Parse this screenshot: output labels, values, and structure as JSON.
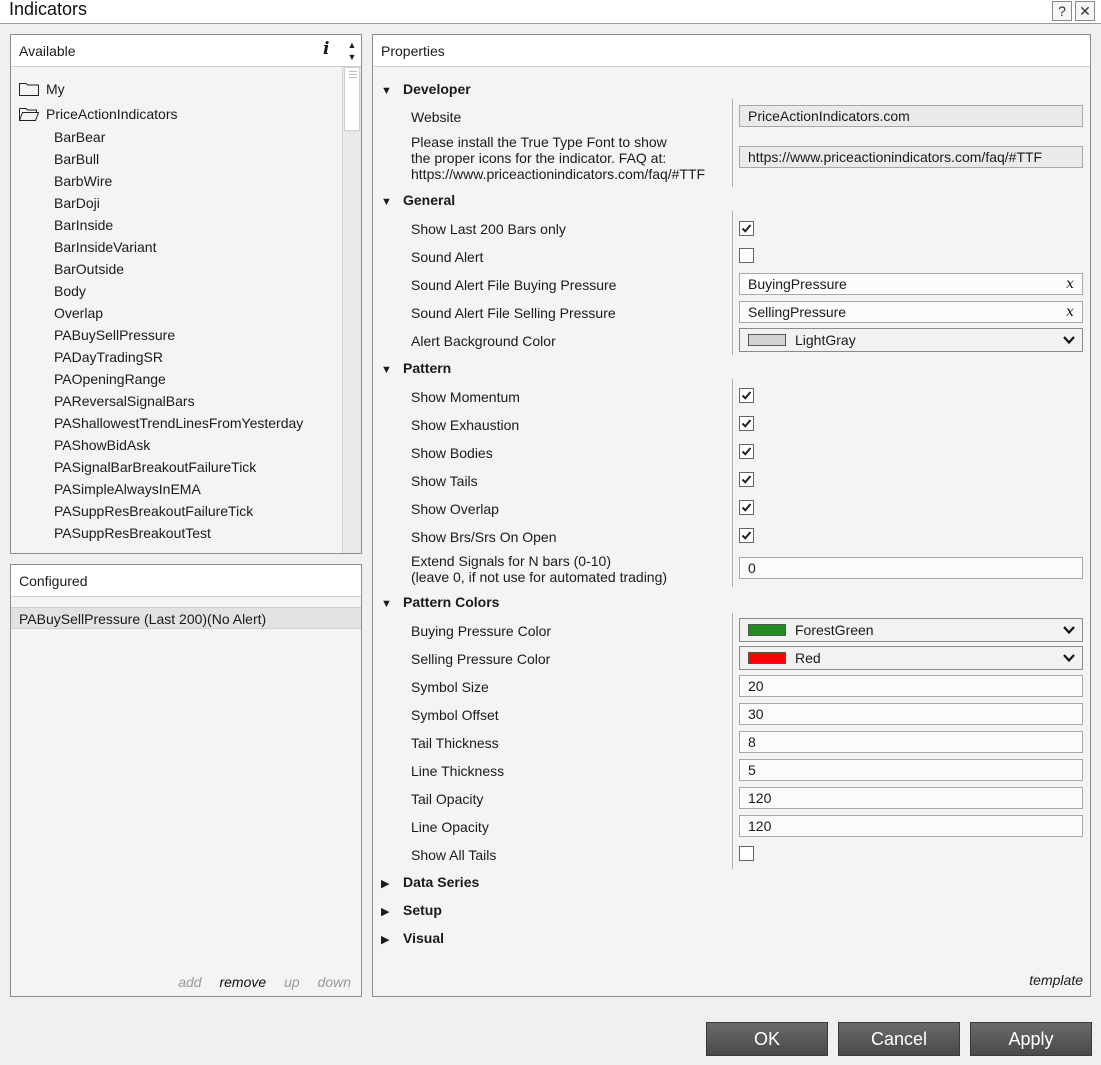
{
  "window": {
    "title": "Indicators",
    "help": "?",
    "close": "✕"
  },
  "available": {
    "header": "Available",
    "info": "i",
    "folders": [
      "My",
      "PriceActionIndicators"
    ],
    "items": [
      "BarBear",
      "BarBull",
      "BarbWire",
      "BarDoji",
      "BarInside",
      "BarInsideVariant",
      "BarOutside",
      "Body",
      "Overlap",
      "PABuySellPressure",
      "PADayTradingSR",
      "PAOpeningRange",
      "PAReversalSignalBars",
      "PAShallowestTrendLinesFromYesterday",
      "PAShowBidAsk",
      "PASignalBarBreakoutFailureTick",
      "PASimpleAlwaysInEMA",
      "PASuppResBreakoutFailureTick",
      "PASuppResBreakoutTest"
    ]
  },
  "configured": {
    "header": "Configured",
    "items": [
      "PABuySellPressure (Last 200)(No Alert)"
    ],
    "actions": {
      "add": "add",
      "remove": "remove",
      "up": "up",
      "down": "down"
    }
  },
  "properties": {
    "header": "Properties",
    "template": "template",
    "developer": {
      "title": "Developer",
      "website_label": "Website",
      "website_value": "PriceActionIndicators.com",
      "font_note": [
        "Please install the True Type Font to show",
        "the proper icons for the indicator. FAQ at:",
        "https://www.priceactionindicators.com/faq/#TTF"
      ],
      "font_value": "https://www.priceactionindicators.com/faq/#TTF"
    },
    "general": {
      "title": "General",
      "last200_label": "Show Last 200 Bars only",
      "last200": true,
      "sound_alert_label": "Sound Alert",
      "sound_alert": false,
      "buy_file_label": "Sound Alert File Buying Pressure",
      "buy_file_value": "BuyingPressure",
      "sell_file_label": "Sound Alert File Selling Pressure",
      "sell_file_value": "SellingPressure",
      "clear": "x",
      "bg_color_label": "Alert Background Color",
      "bg_color_value": "LightGray",
      "bg_color_swatch": "#d3d3d3"
    },
    "pattern": {
      "title": "Pattern",
      "momentum_label": "Show Momentum",
      "momentum": true,
      "exhaustion_label": "Show Exhaustion",
      "exhaustion": true,
      "bodies_label": "Show Bodies",
      "bodies": true,
      "tails_label": "Show Tails",
      "tails": true,
      "overlap_label": "Show Overlap",
      "overlap": true,
      "brs_label": "Show Brs/Srs On Open",
      "brs": true,
      "extend_label": [
        "Extend Signals for N bars (0-10)",
        "(leave 0, if not use for automated trading)"
      ],
      "extend_value": "0"
    },
    "pattern_colors": {
      "title": "Pattern Colors",
      "buy_color_label": "Buying Pressure Color",
      "buy_color_value": "ForestGreen",
      "buy_color_swatch": "#228b22",
      "sell_color_label": "Selling Pressure Color",
      "sell_color_value": "Red",
      "sell_color_swatch": "#ff0000",
      "symbol_size_label": "Symbol Size",
      "symbol_size": "20",
      "symbol_offset_label": "Symbol Offset",
      "symbol_offset": "30",
      "tail_thickness_label": "Tail Thickness",
      "tail_thickness": "8",
      "line_thickness_label": "Line Thickness",
      "line_thickness": "5",
      "tail_opacity_label": "Tail Opacity",
      "tail_opacity": "120",
      "line_opacity_label": "Line Opacity",
      "line_opacity": "120",
      "all_tails_label": "Show All Tails",
      "all_tails": false
    },
    "collapsed": [
      "Data Series",
      "Setup",
      "Visual"
    ]
  },
  "buttons": {
    "ok": "OK",
    "cancel": "Cancel",
    "apply": "Apply"
  }
}
